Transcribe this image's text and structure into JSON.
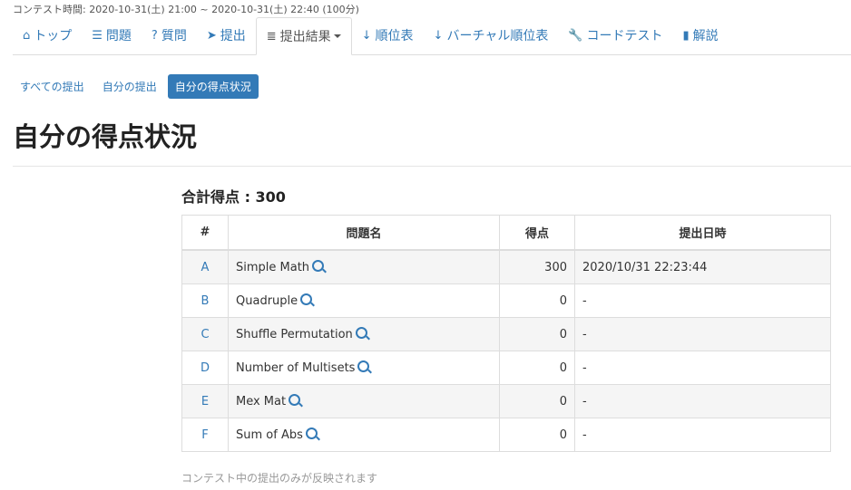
{
  "contest_time": "コンテスト時間: 2020-10-31(土) 21:00 ~ 2020-10-31(土) 22:40 (100分)",
  "nav": {
    "top": "トップ",
    "tasks": "問題",
    "faq": "質問",
    "submit": "提出",
    "results": "提出結果",
    "standings": "順位表",
    "virtual": "バーチャル順位表",
    "codetest": "コードテスト",
    "editorial": "解説"
  },
  "subnav": {
    "all": "すべての提出",
    "mine": "自分の提出",
    "score": "自分の得点状況"
  },
  "title": "自分の得点状況",
  "total": "合計得点 : 300",
  "table": {
    "headers": [
      "#",
      "問題名",
      "得点",
      "提出日時"
    ],
    "rows": [
      {
        "id": "A",
        "name": "Simple Math",
        "score": "300",
        "time": "2020/10/31 22:23:44"
      },
      {
        "id": "B",
        "name": "Quadruple",
        "score": "0",
        "time": "-"
      },
      {
        "id": "C",
        "name": "Shuffle Permutation",
        "score": "0",
        "time": "-"
      },
      {
        "id": "D",
        "name": "Number of Multisets",
        "score": "0",
        "time": "-"
      },
      {
        "id": "E",
        "name": "Mex Mat",
        "score": "0",
        "time": "-"
      },
      {
        "id": "F",
        "name": "Sum of Abs",
        "score": "0",
        "time": "-"
      }
    ]
  },
  "note": "コンテスト中の提出のみが反映されます",
  "colors": {
    "link": "#337ab7",
    "active_pill": "#337ab7"
  }
}
